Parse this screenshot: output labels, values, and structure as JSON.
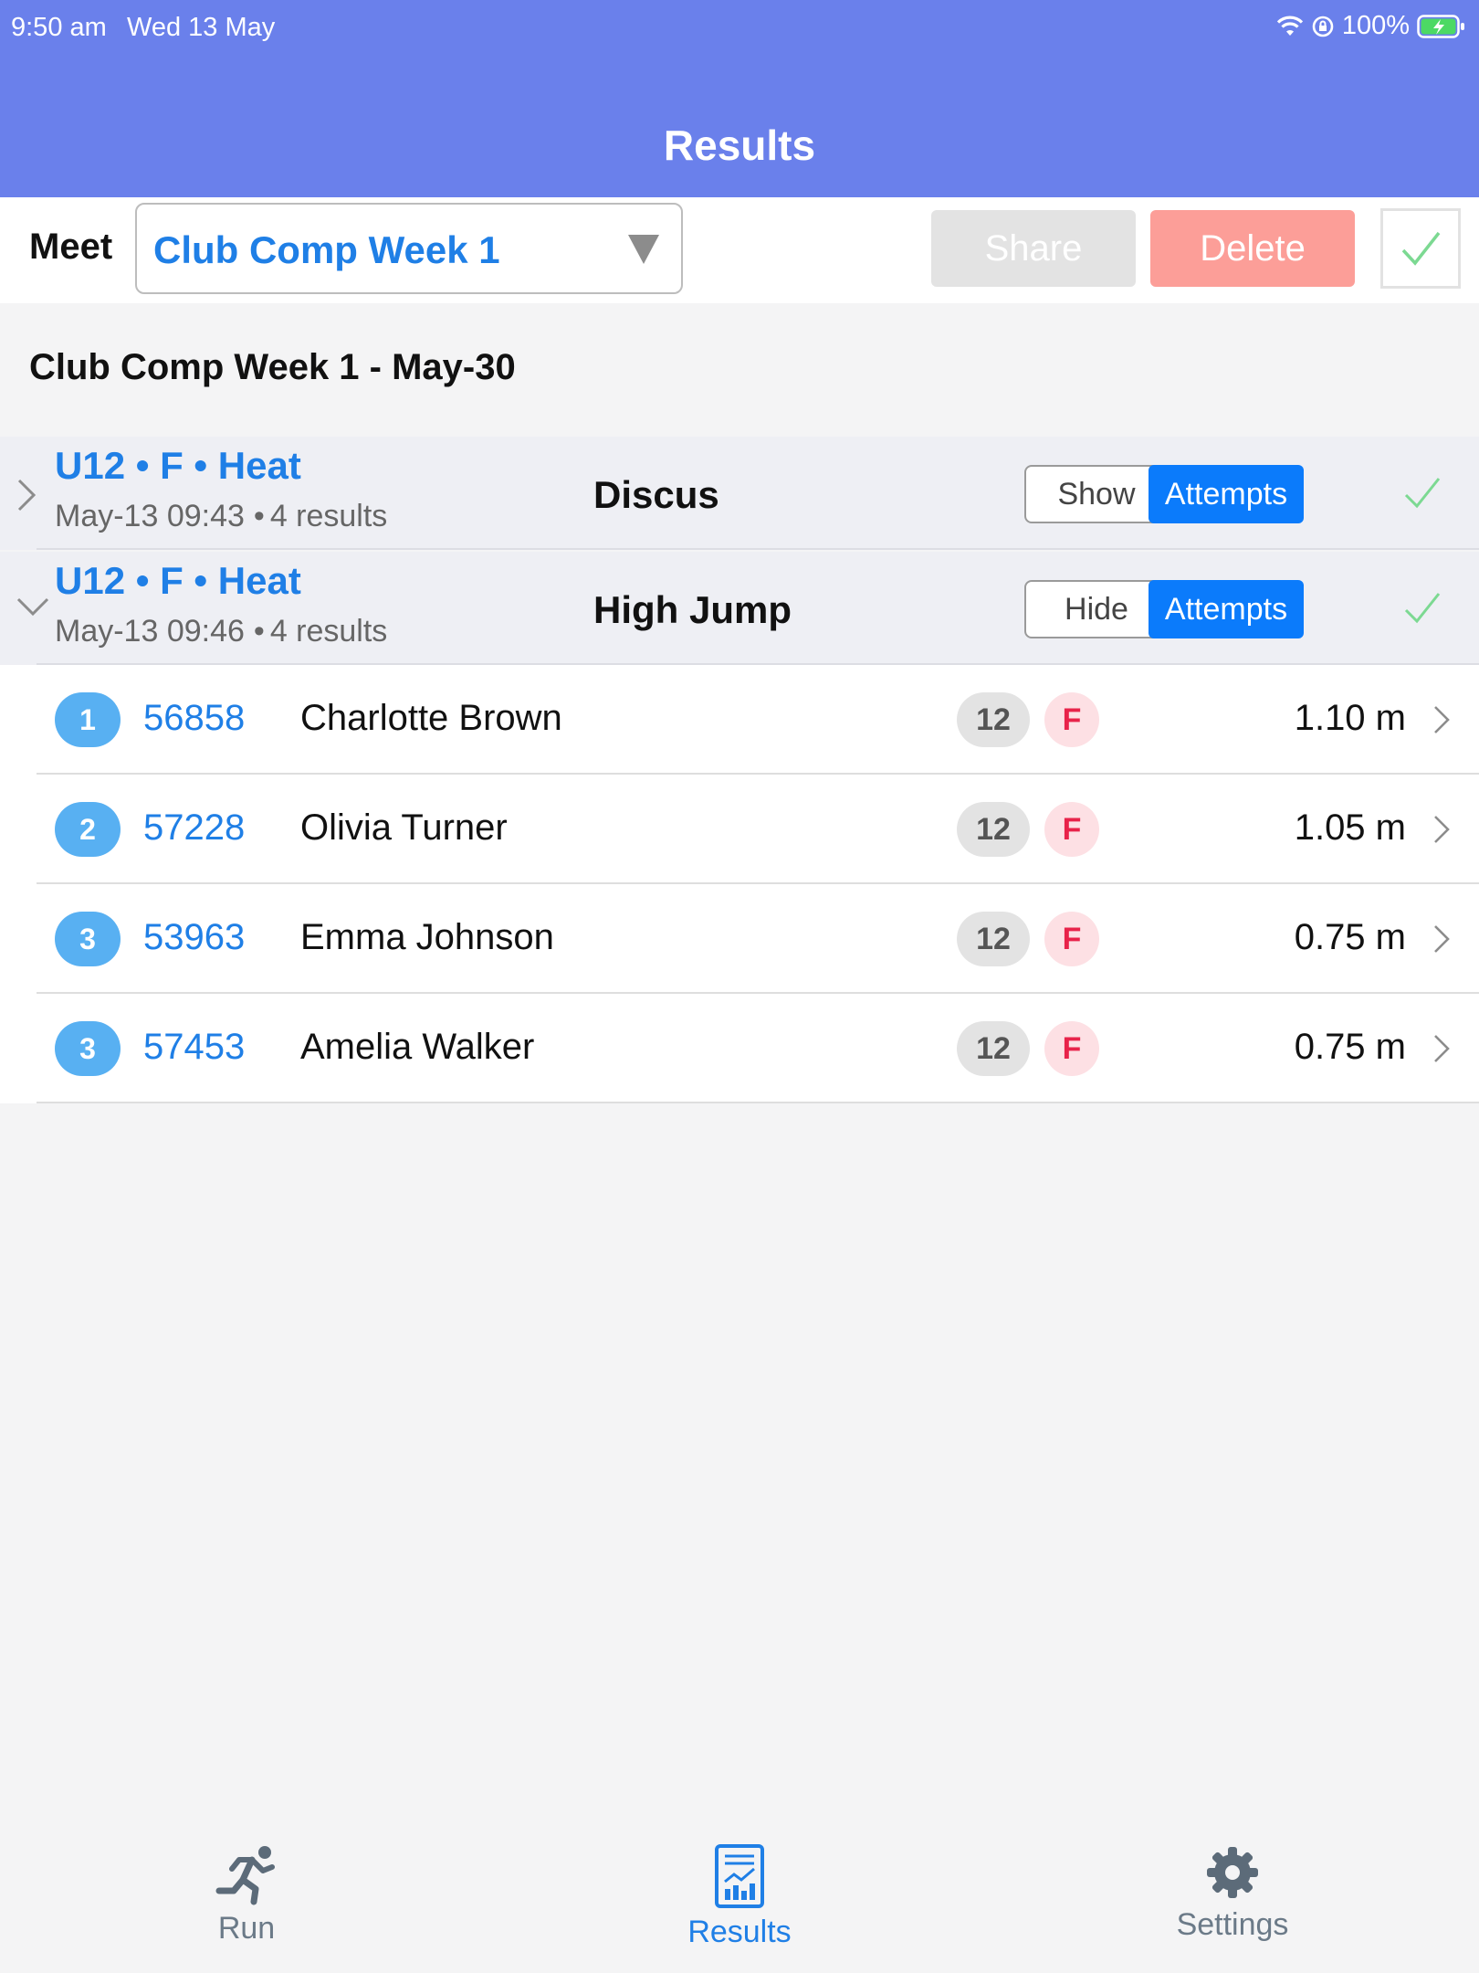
{
  "status_bar": {
    "time": "9:50 am",
    "date": "Wed 13 May",
    "battery": "100%"
  },
  "nav": {
    "title": "Results"
  },
  "toolbar": {
    "meet_label": "Meet",
    "meet_value": "Club Comp Week 1",
    "share_label": "Share",
    "delete_label": "Delete"
  },
  "section": {
    "title": "Club Comp Week 1 - May-30"
  },
  "events": [
    {
      "group": "U12 • F • Heat",
      "datetime": "May-13 09:43",
      "count": "4 results",
      "name": "Discus",
      "toggle_label": "Show",
      "attempts_label": "Attempts",
      "expanded": false
    },
    {
      "group": "U12 • F • Heat",
      "datetime": "May-13 09:46",
      "count": "4 results",
      "name": "High Jump",
      "toggle_label": "Hide",
      "attempts_label": "Attempts",
      "expanded": true
    }
  ],
  "results": [
    {
      "rank": "1",
      "bib": "56858",
      "name": "Charlotte Brown",
      "age": "12",
      "sex": "F",
      "mark": "1.10 m"
    },
    {
      "rank": "2",
      "bib": "57228",
      "name": "Olivia Turner",
      "age": "12",
      "sex": "F",
      "mark": "1.05 m"
    },
    {
      "rank": "3",
      "bib": "53963",
      "name": "Emma Johnson",
      "age": "12",
      "sex": "F",
      "mark": "0.75 m"
    },
    {
      "rank": "3",
      "bib": "57453",
      "name": "Amelia Walker",
      "age": "12",
      "sex": "F",
      "mark": "0.75 m"
    }
  ],
  "tabbar": {
    "tabs": [
      {
        "label": "Run",
        "icon": "runner-icon",
        "active": false
      },
      {
        "label": "Results",
        "icon": "results-report-icon",
        "active": true
      },
      {
        "label": "Settings",
        "icon": "gear-icon",
        "active": false
      }
    ]
  },
  "colors": {
    "header": "#6a80eb",
    "accent": "#1f7fe6",
    "attempts_button": "#0b7bfb",
    "delete_button": "#fc9e98",
    "check": "#7cd992",
    "rank_badge": "#58b0f2"
  }
}
